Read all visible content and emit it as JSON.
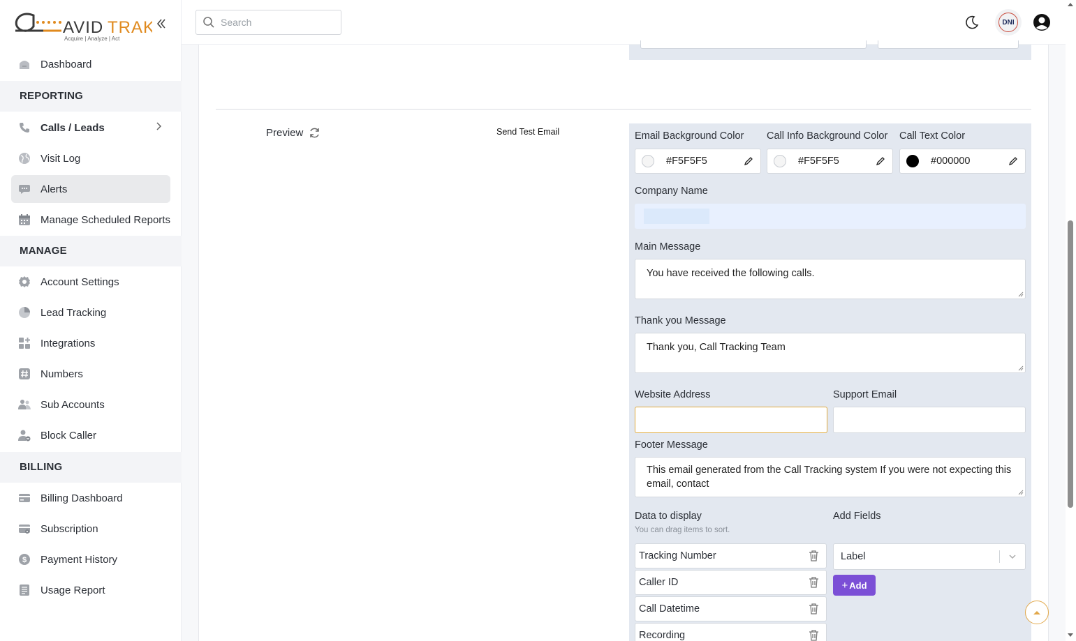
{
  "brand": {
    "name": "AVIDTRAK",
    "tagline": "Acquire  |  Analyze  |  Act",
    "accent": "#e08a1e"
  },
  "sidebar": {
    "dashboard": "Dashboard",
    "reporting_header": "REPORTING",
    "reporting_items": [
      {
        "label": "Calls / Leads",
        "icon": "phone-icon"
      },
      {
        "label": "Visit Log",
        "icon": "globe-icon"
      },
      {
        "label": "Alerts",
        "icon": "chat-icon"
      },
      {
        "label": "Manage Scheduled Reports",
        "icon": "calendar-icon"
      }
    ],
    "manage_header": "MANAGE",
    "manage_items": [
      {
        "label": "Account Settings",
        "icon": "gear-icon"
      },
      {
        "label": "Lead Tracking",
        "icon": "pie-icon"
      },
      {
        "label": "Integrations",
        "icon": "grid-plus-icon"
      },
      {
        "label": "Numbers",
        "icon": "hash-icon"
      },
      {
        "label": "Sub Accounts",
        "icon": "users-icon"
      },
      {
        "label": "Block Caller",
        "icon": "user-block-icon"
      }
    ],
    "billing_header": "BILLING",
    "billing_items": [
      {
        "label": "Billing Dashboard",
        "icon": "card-icon"
      },
      {
        "label": "Subscription",
        "icon": "card-gear-icon"
      },
      {
        "label": "Payment History",
        "icon": "dollar-icon"
      },
      {
        "label": "Usage Report",
        "icon": "report-icon"
      }
    ]
  },
  "topbar": {
    "search_placeholder": "Search",
    "dni_label": "DNI"
  },
  "content": {
    "preview_label": "Preview",
    "send_test_label": "Send Test Email",
    "email_bg_label": "Email Background Color",
    "email_bg_value": "#F5F5F5",
    "call_info_bg_label": "Call Info Background Color",
    "call_info_bg_value": "#F5F5F5",
    "call_text_label": "Call Text Color",
    "call_text_value": "#000000",
    "company_name_label": "Company Name",
    "company_name_value": "",
    "main_message_label": "Main Message",
    "main_message_value": "You have received the following calls.",
    "thank_you_label": "Thank you Message",
    "thank_you_value": "Thank you, Call Tracking Team",
    "website_label": "Website Address",
    "website_value": "",
    "support_email_label": "Support Email",
    "support_email_value": "",
    "footer_label": "Footer Message",
    "footer_value": "This email generated from the Call Tracking system If you were not expecting this email, contact",
    "data_display_label": "Data to display",
    "data_display_hint": "You can drag items to sort.",
    "data_items": [
      "Tracking Number",
      "Caller ID",
      "Call Datetime",
      "Recording"
    ],
    "add_fields_label": "Add Fields",
    "add_fields_selected": "Label",
    "add_button": "Add",
    "add_button_color": "#7b4fd6"
  }
}
